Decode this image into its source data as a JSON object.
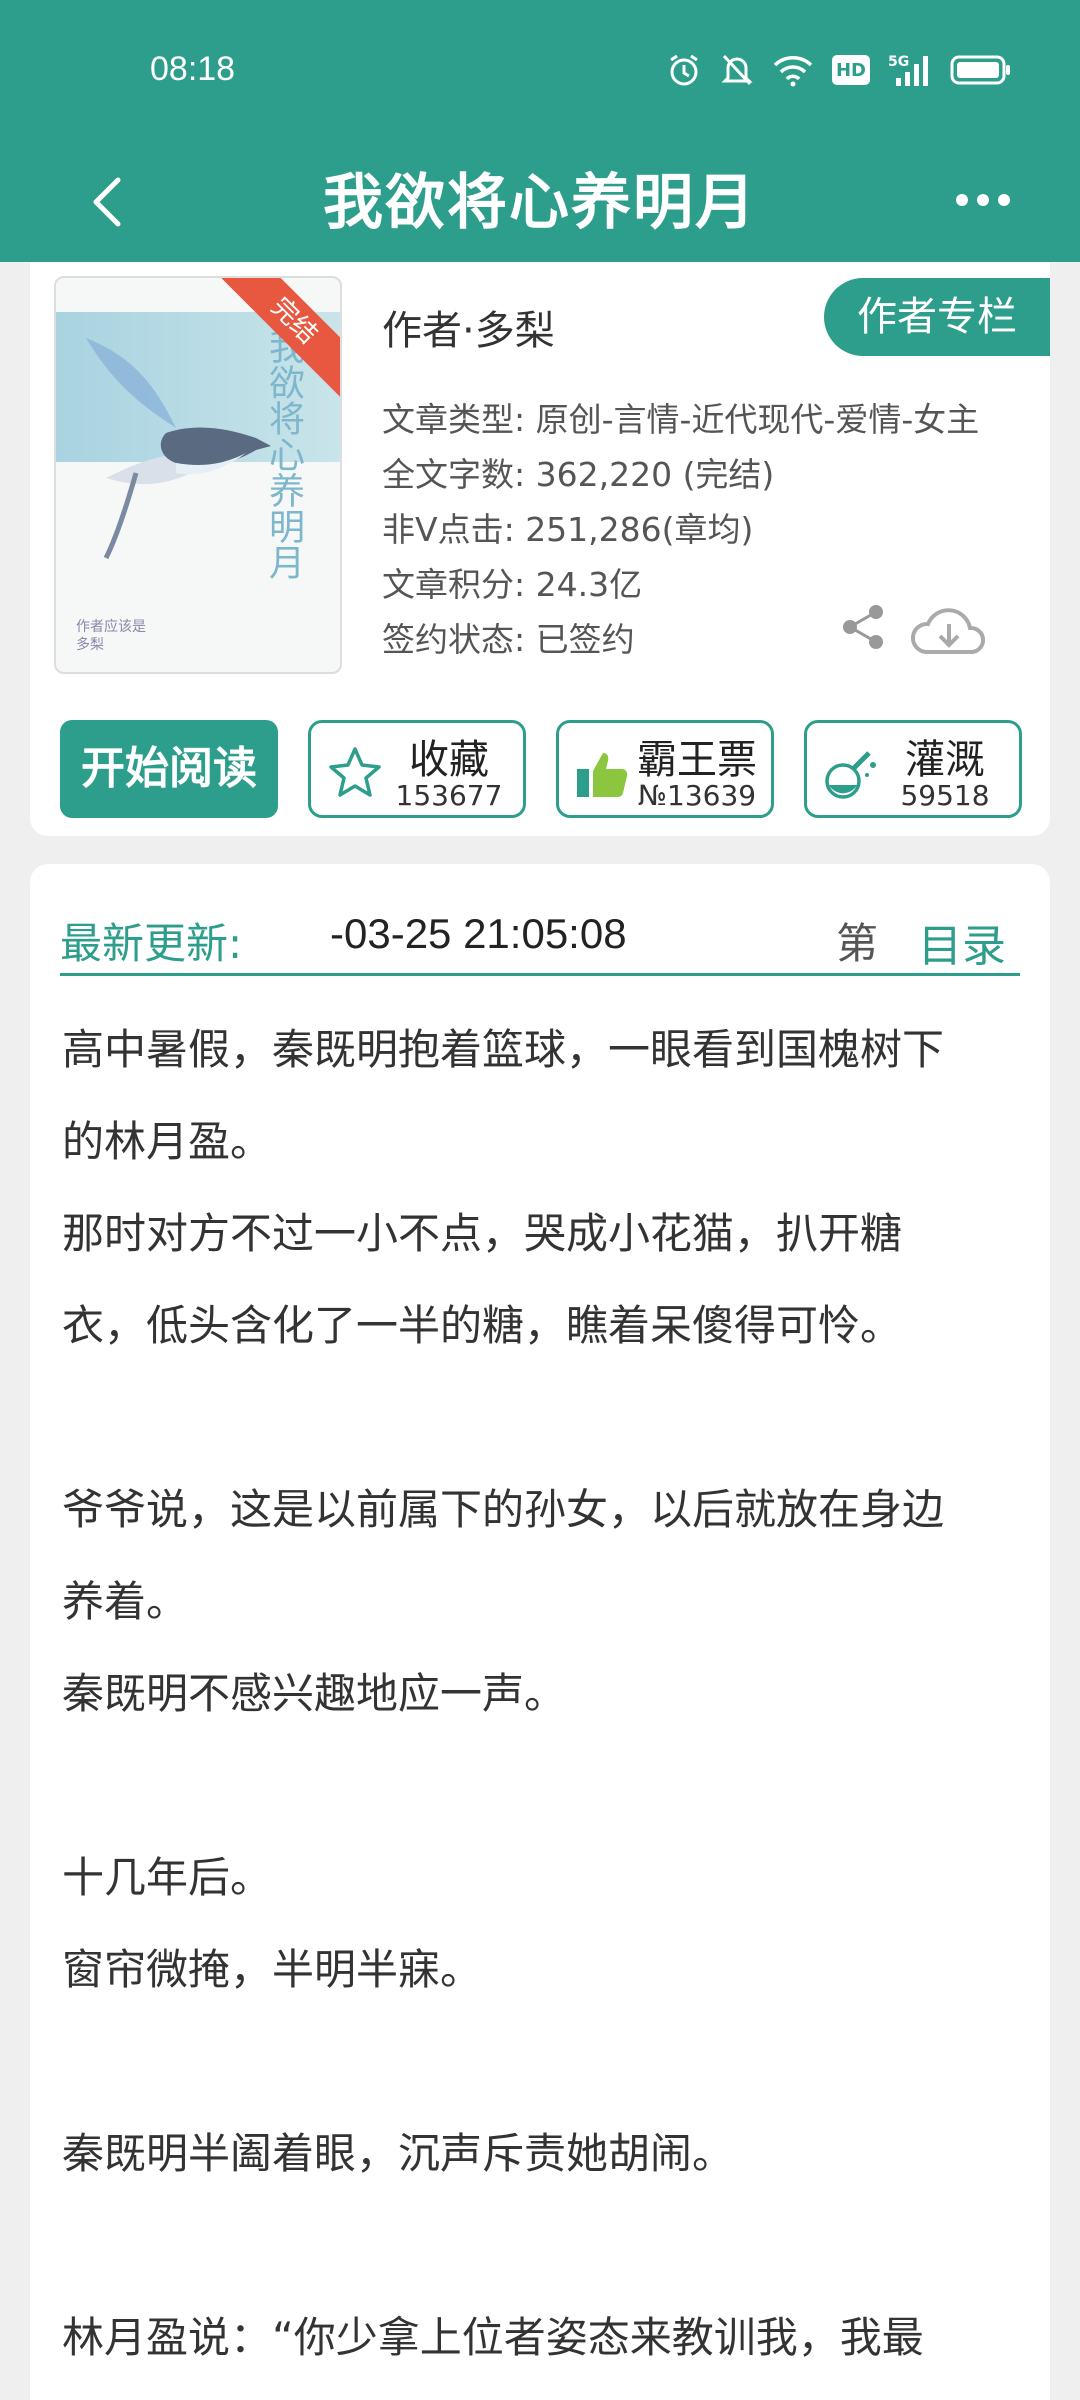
{
  "status_bar": {
    "time": "08:18",
    "icons": [
      "alarm-icon",
      "mute-bell-icon",
      "wifi-icon",
      "hd-icon",
      "5g-signal-icon",
      "battery-icon"
    ],
    "hd_label": "HD",
    "network_label": "5G"
  },
  "header": {
    "title": "我欲将心养明月"
  },
  "cover": {
    "vertical_title": "我欲将心养明月",
    "ribbon": "完结",
    "small_text_1": "作者应该是",
    "small_text_2": "多梨"
  },
  "book": {
    "author": "作者·多梨",
    "author_column_btn": "作者专栏",
    "meta": [
      {
        "label": "文章类型: ",
        "value": "原创-言情-近代现代-爱情-女主"
      },
      {
        "label": "全文字数: ",
        "value": "362,220 (完结)"
      },
      {
        "label": "非V点击: ",
        "value": "251,286(章均)"
      },
      {
        "label": "文章积分: ",
        "value": "24.3亿"
      },
      {
        "label": "签约状态: ",
        "value": "已签约"
      }
    ]
  },
  "actions": {
    "read": "开始阅读",
    "collect": {
      "label": "收藏",
      "count": "153677"
    },
    "bawang": {
      "label": "霸王票",
      "count": "№13639"
    },
    "irrigate": {
      "label": "灌溉",
      "count": "59518"
    }
  },
  "update": {
    "label": "最新更新:",
    "time": "-03-25 21:05:08",
    "chapter": "第",
    "catalog": "目录"
  },
  "intro_lines": [
    "高中暑假，秦既明抱着篮球，一眼看到国槐树下",
    "的林月盈。",
    "那时对方不过一小不点，哭成小花猫，扒开糖",
    "衣，低头含化了一半的糖，瞧着呆傻得可怜。",
    "",
    "爷爷说，这是以前属下的孙女，以后就放在身边",
    "养着。",
    "秦既明不感兴趣地应一声。",
    "",
    "十几年后。",
    "窗帘微掩，半明半寐。",
    "",
    "秦既明半阖着眼，沉声斥责她胡闹。",
    "",
    "林月盈说：“你少拿上位者姿态来教训我，我最"
  ],
  "colors": {
    "primary": "#2e9e8c",
    "ribbon": "#e8573f"
  }
}
